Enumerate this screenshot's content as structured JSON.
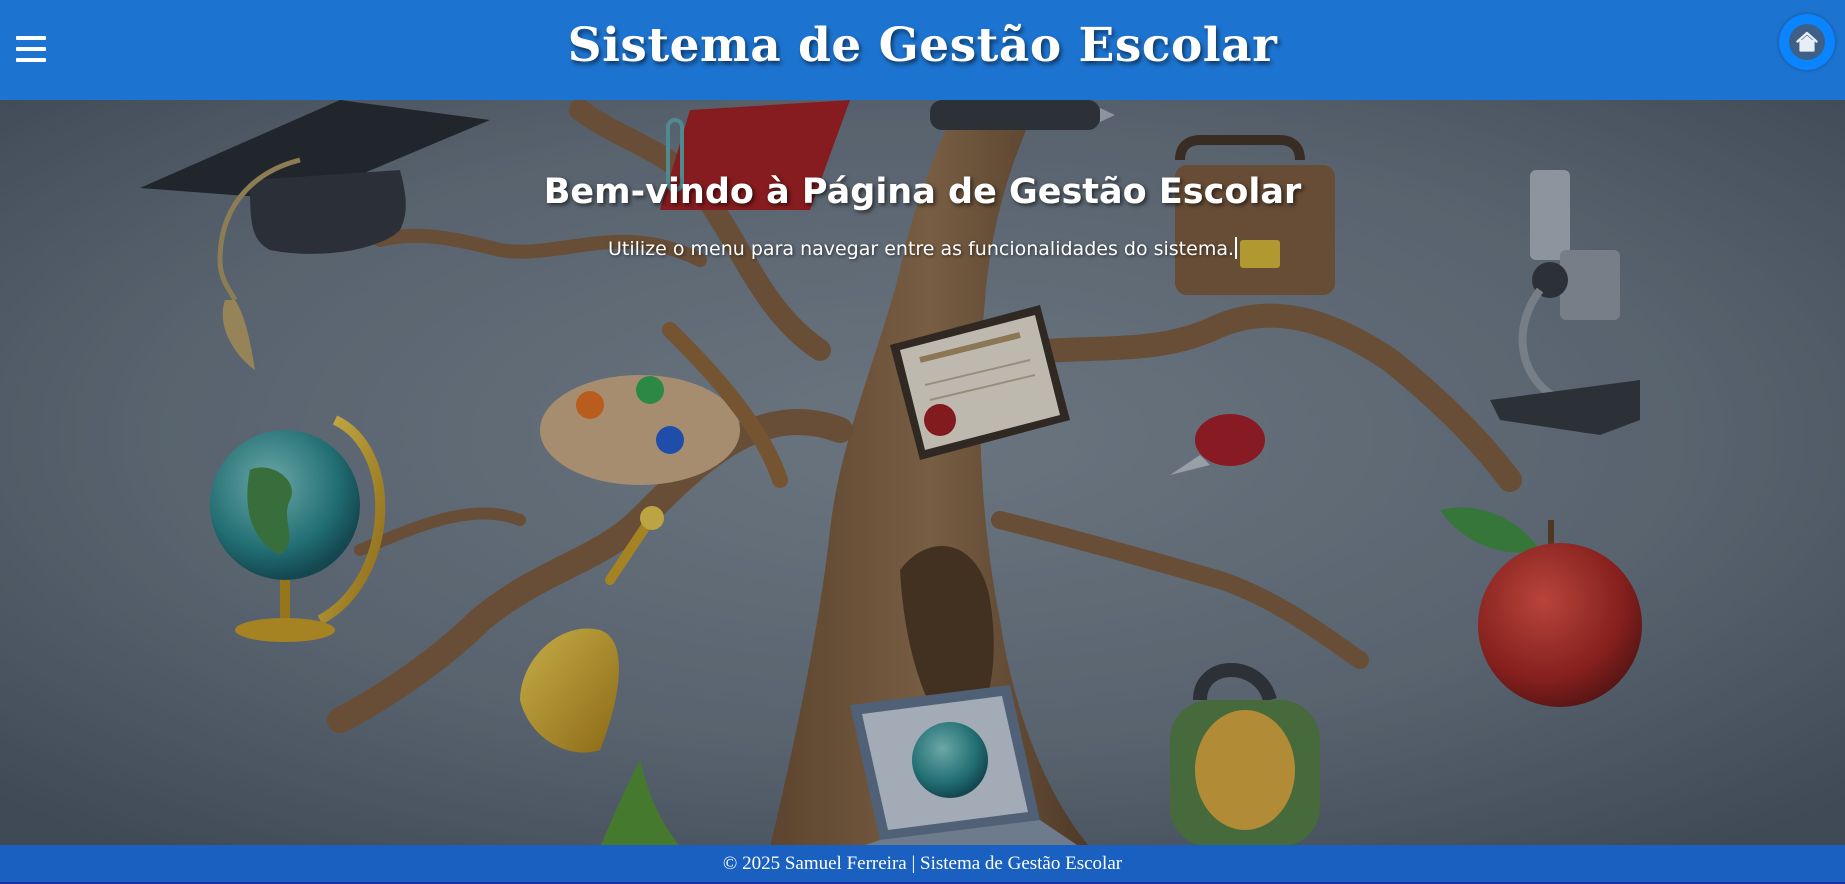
{
  "header": {
    "title": "Sistema de Gestão Escolar",
    "menu_icon": "hamburger-menu-icon",
    "home_icon": "home-icon"
  },
  "main": {
    "welcome_title": "Bem-vindo à Página de Gestão Escolar",
    "welcome_text": "Utilize o menu para navegar entre as funcionalidades do sistema."
  },
  "footer": {
    "text": "© 2025 Samuel Ferreira | Sistema de Gestão Escolar"
  },
  "colors": {
    "header_bg": "#1d74d0",
    "footer_bg": "#1960c0",
    "home_button": "#0a84ff",
    "scene_bg": "#5b6670"
  }
}
